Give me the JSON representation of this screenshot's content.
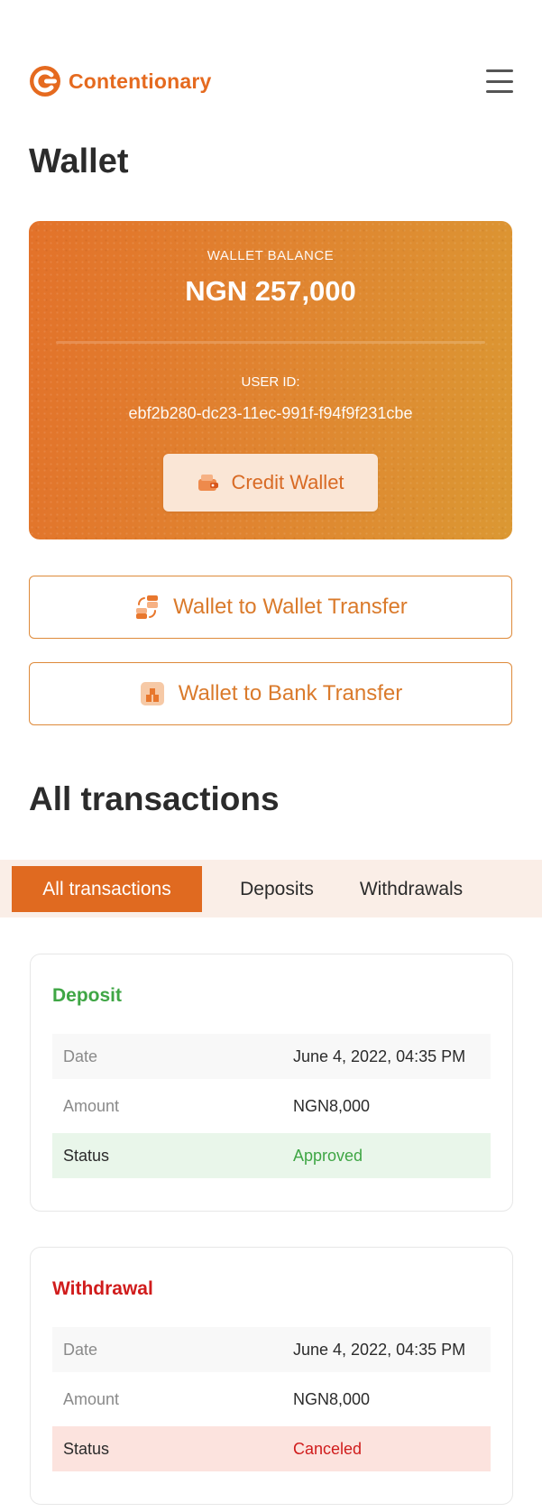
{
  "header": {
    "brand": "Contentionary",
    "menu_icon": "hamburger-menu-icon"
  },
  "page_title": "Wallet",
  "wallet": {
    "balance_label": "WALLET BALANCE",
    "balance": "NGN 257,000",
    "user_id_label": "USER ID:",
    "user_id": "ebf2b280-dc23-11ec-991f-f94f9f231cbe",
    "credit_button": "Credit Wallet"
  },
  "actions": {
    "wallet_to_wallet": "Wallet to Wallet Transfer",
    "wallet_to_bank": "Wallet to Bank Transfer"
  },
  "transactions": {
    "title": "All transactions",
    "tabs": [
      {
        "label": "All transactions",
        "active": true
      },
      {
        "label": "Deposits",
        "active": false
      },
      {
        "label": "Withdrawals",
        "active": false
      }
    ],
    "items": [
      {
        "type": "Deposit",
        "rows": [
          {
            "key": "Date",
            "value": "June 4, 2022, 04:35 PM"
          },
          {
            "key": "Amount",
            "value": "NGN8,000"
          },
          {
            "key": "Status",
            "value": "Approved"
          }
        ]
      },
      {
        "type": "Withdrawal",
        "rows": [
          {
            "key": "Date",
            "value": "June 4, 2022, 04:35 PM"
          },
          {
            "key": "Amount",
            "value": "NGN8,000"
          },
          {
            "key": "Status",
            "value": "Canceled"
          }
        ]
      }
    ]
  },
  "colors": {
    "brand": "#E56A1F",
    "deposit": "#3FA645",
    "withdrawal": "#D01C1C"
  }
}
